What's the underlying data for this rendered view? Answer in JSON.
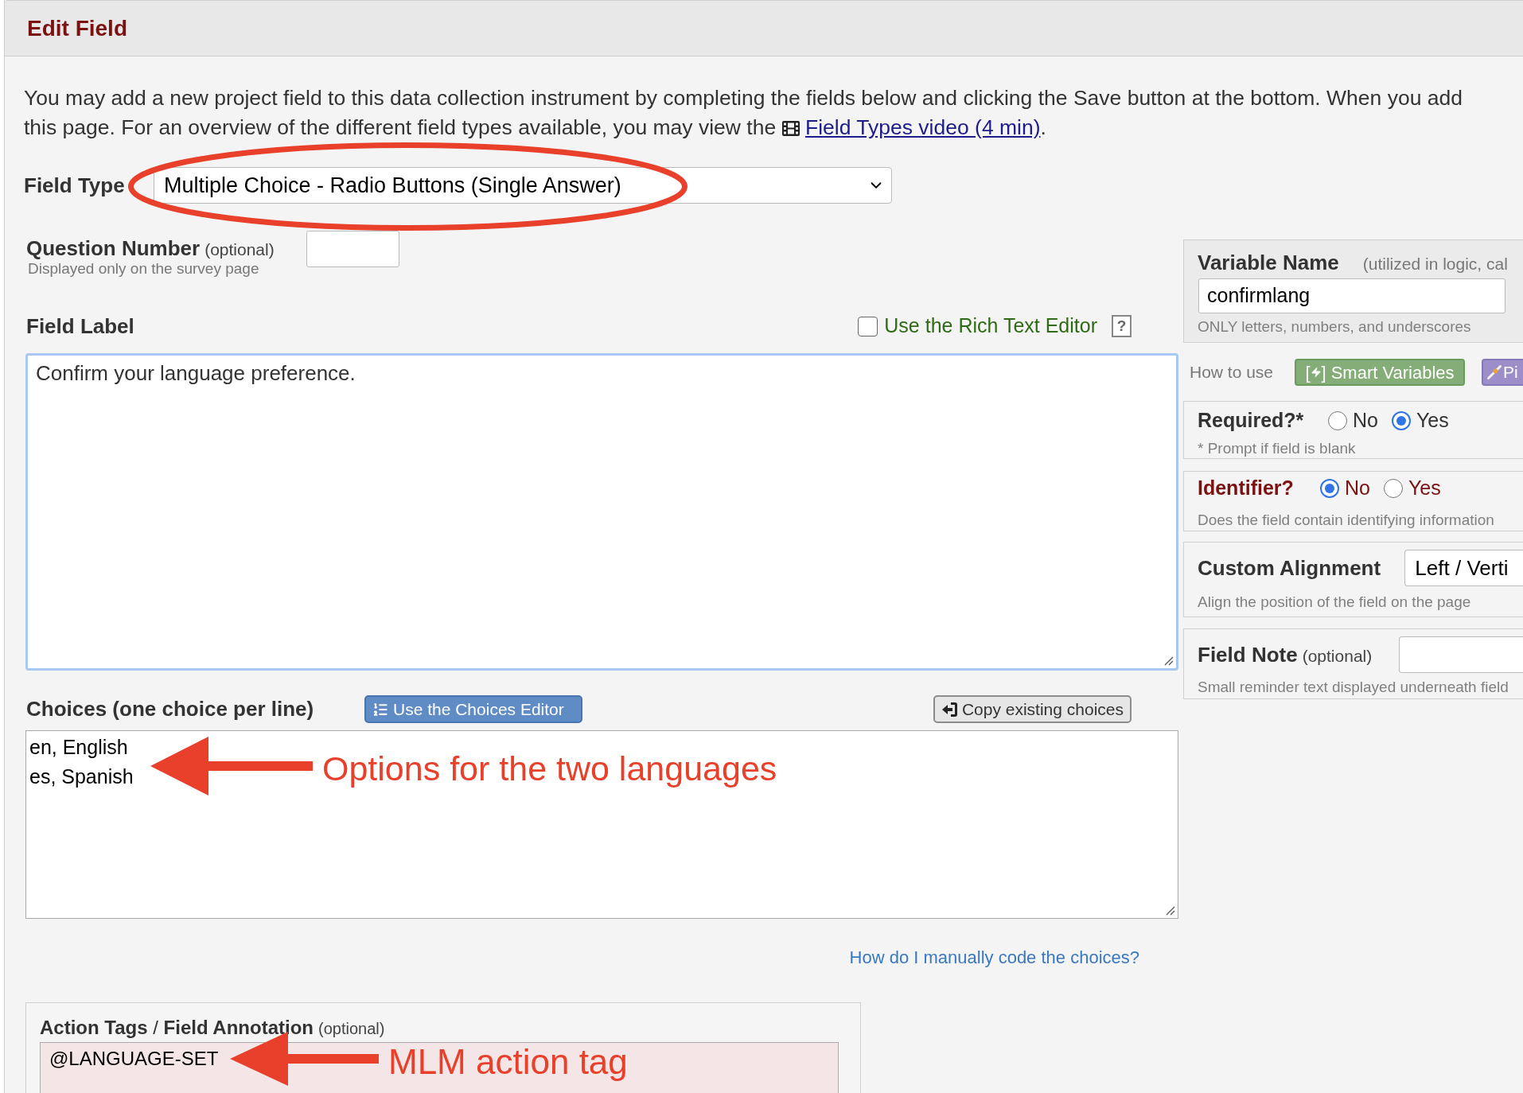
{
  "header": {
    "title": "Edit Field"
  },
  "intro": {
    "lines": [
      "You may add a new project field to this data collection instrument by completing the fields below and clicking the Save button at the bottom. When you add",
      "this page. For an overview of the different field types available, you may view the"
    ],
    "link": "Field Types video (4 min)",
    "after_link": "."
  },
  "field_type": {
    "label": "Field Type",
    "value": "Multiple Choice - Radio Buttons (Single Answer)"
  },
  "question_number": {
    "label": "Question Number",
    "optional": "(optional)",
    "hint": "Displayed only on the survey page"
  },
  "field_label": {
    "label": "Field Label",
    "rich_text_editor": {
      "label": "Use the Rich Text Editor",
      "checked": false
    },
    "help": "?",
    "value": "Confirm your language preference."
  },
  "choices": {
    "label": "Choices (one choice per line)",
    "editor_button": "Use the Choices Editor",
    "copy_button": "Copy existing choices",
    "lines": [
      "en, English",
      "es, Spanish"
    ],
    "annotation": "Options for the two languages",
    "help_link": "How do I manually code the choices?"
  },
  "action_tags": {
    "label": "**Action Tags** / **Field Annotation**",
    "optional": "(optional)",
    "value": "@LANGUAGE-SET",
    "annotation": "MLM action tag"
  },
  "variable_name": {
    "label": "Variable Name",
    "note": "(utilized in logic, cal",
    "value": "confirmlang",
    "hint": "ONLY letters, numbers, and underscores"
  },
  "how_to_use": {
    "label": "How to use",
    "buttons": [
      {
        "kind": "smart_variables",
        "brackets": [
          "[",
          "]"
        ],
        "label": "Smart Variables"
      },
      {
        "kind": "piping",
        "label": "Pi"
      }
    ]
  },
  "required": {
    "label": "Required?*",
    "options": [
      {
        "label": "No",
        "selected": false
      },
      {
        "label": "Yes",
        "selected": true
      }
    ],
    "hint": "* Prompt if field is blank"
  },
  "identifier": {
    "label": "Identifier?",
    "options": [
      {
        "label": "No",
        "selected": true
      },
      {
        "label": "Yes",
        "selected": false
      }
    ],
    "hint": "Does the field contain identifying information"
  },
  "custom_alignment": {
    "label": "Custom Alignment",
    "value": "Left / Verti",
    "hint": "Align the position of the field on the page"
  },
  "field_note": {
    "label": "Field Note",
    "optional": "(optional)",
    "hint": "Small reminder text displayed underneath field"
  }
}
